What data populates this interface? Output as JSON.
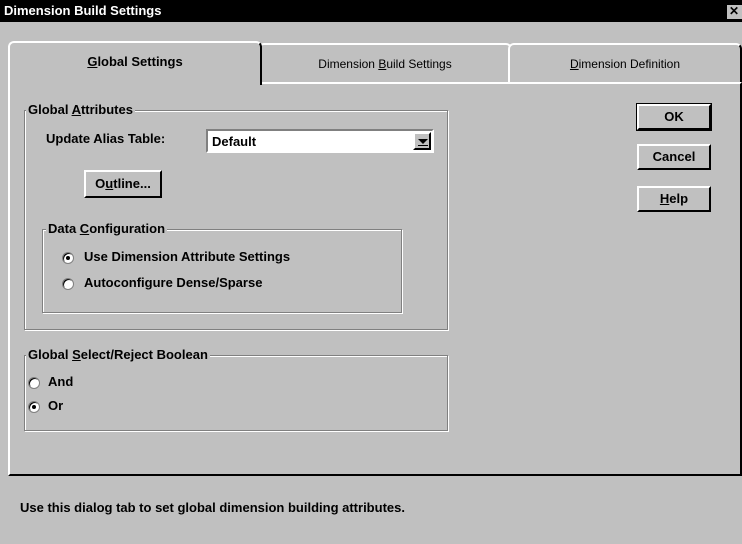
{
  "window": {
    "title": "Dimension Build Settings",
    "close_glyph": "✕"
  },
  "tabs": [
    {
      "label": "Global Settings",
      "active": true
    },
    {
      "label": "Dimension Build Settings",
      "active": false
    },
    {
      "label": "Dimension Definition",
      "active": false
    }
  ],
  "global_attributes": {
    "legend": "Global Attributes",
    "alias_label": "Update Alias Table:",
    "alias_value": "Default",
    "outline_button": "Outline..."
  },
  "data_configuration": {
    "legend": "Data Configuration",
    "options": [
      {
        "label": "Use Dimension Attribute Settings",
        "selected": true
      },
      {
        "label": "Autoconfigure Dense/Sparse",
        "selected": false
      }
    ]
  },
  "boolean": {
    "legend": "Global Select/Reject Boolean",
    "options": [
      {
        "label": "And",
        "selected": false
      },
      {
        "label": "Or",
        "selected": true
      }
    ]
  },
  "buttons": {
    "ok": "OK",
    "cancel": "Cancel",
    "help": "Help"
  },
  "status_text": "Use this dialog tab to set global dimension building attributes."
}
